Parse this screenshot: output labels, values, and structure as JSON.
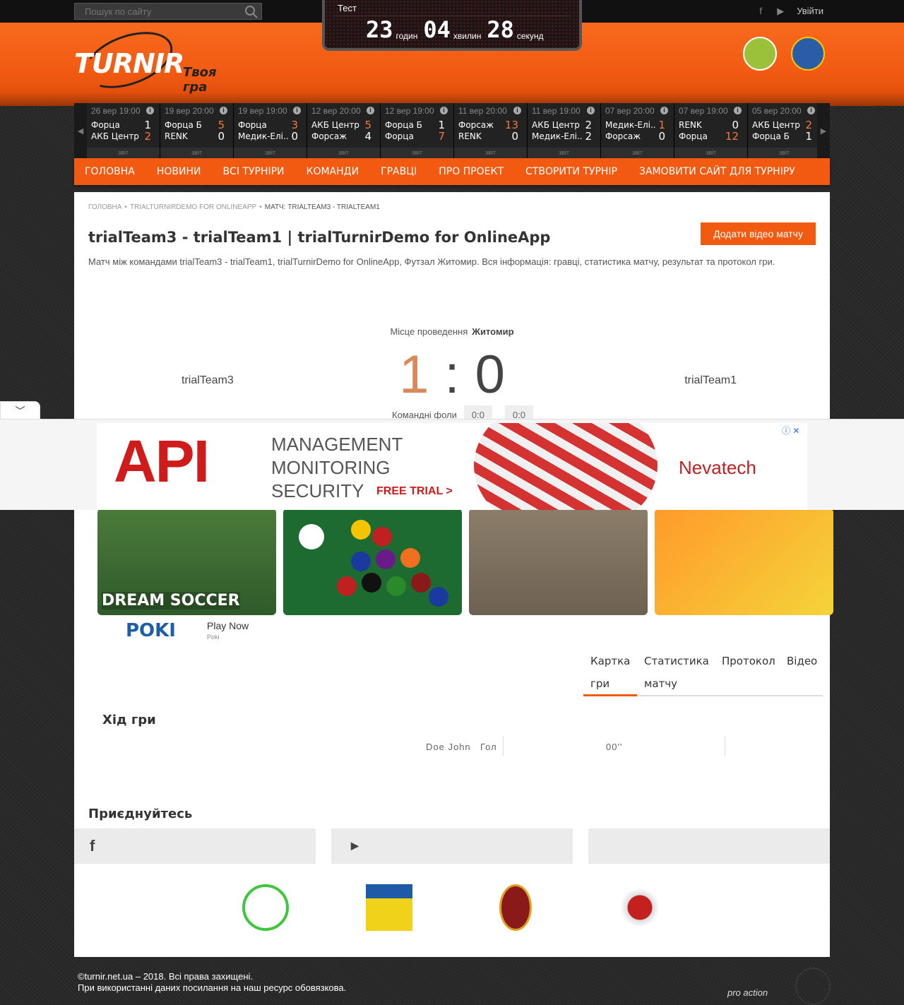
{
  "search": {
    "placeholder": "Пошук по сайту"
  },
  "top": {
    "login": "Увійти"
  },
  "countdown": {
    "title": "Тест",
    "hours": "23",
    "hours_label": "годин",
    "minutes": "04",
    "minutes_label": "хвилин",
    "seconds": "28",
    "seconds_label": "секунд"
  },
  "logo": {
    "text": "TURNIR",
    "tagline": "Твоя гра"
  },
  "matches": [
    {
      "date": "26 вер 19:00",
      "team1": "Форца",
      "score1": "1",
      "team2": "АКБ Центр",
      "score2": "2",
      "report": "звіт",
      "winner": 2
    },
    {
      "date": "19 вер 20:00",
      "team1": "Форца Б",
      "score1": "5",
      "team2": "RENK",
      "score2": "0",
      "report": "звіт",
      "winner": 1
    },
    {
      "date": "19 вер 19:00",
      "team1": "Форца",
      "score1": "3",
      "team2": "Медик-Елі..",
      "score2": "0",
      "report": "звіт",
      "winner": 1
    },
    {
      "date": "12 вер 20:00",
      "team1": "АКБ Центр",
      "score1": "5",
      "team2": "Форсаж",
      "score2": "4",
      "report": "звіт",
      "winner": 1
    },
    {
      "date": "12 вер 19:00",
      "team1": "Форца Б",
      "score1": "1",
      "team2": "Форца",
      "score2": "7",
      "report": "звіт",
      "winner": 2
    },
    {
      "date": "11 вер 20:00",
      "team1": "Форсаж",
      "score1": "13",
      "team2": "RENK",
      "score2": "0",
      "report": "звіт",
      "winner": 1
    },
    {
      "date": "11 вер 19:00",
      "team1": "АКБ Центр",
      "score1": "2",
      "team2": "Медик-Елі..",
      "score2": "2",
      "report": "звіт",
      "winner": 0
    },
    {
      "date": "07 вер 20:00",
      "team1": "Медик-Елі..",
      "score1": "1",
      "team2": "Форсаж",
      "score2": "0",
      "report": "звіт",
      "winner": 1
    },
    {
      "date": "07 вер 19:00",
      "team1": "RENK",
      "score1": "0",
      "team2": "Форца",
      "score2": "12",
      "report": "звіт",
      "winner": 2
    },
    {
      "date": "05 вер 20:00",
      "team1": "АКБ Центр",
      "score1": "2",
      "team2": "Форца Б",
      "score2": "1",
      "report": "звіт",
      "winner": 1
    }
  ],
  "nav": [
    "Головна",
    "Новини",
    "Всі турніри",
    "Команди",
    "Гравці",
    "Про проект",
    "Створити турнір",
    "Замовити сайт для турніру"
  ],
  "breadcrumb": {
    "home": "Головна",
    "tournament": "trialTurnirDemo for OnlineApp",
    "current": "Матч: trialTeam3 - trialTeam1"
  },
  "match": {
    "title": "trialTeam3 - trialTeam1 | trialTurnirDemo for OnlineApp",
    "add_video": "Додати відео матчу",
    "description": "Матч між командами trialTeam3 - trialTeam1, trialTurnirDemo for OnlineApp, Футзал Житомир. Вся інформація: гравці, статистика матчу, результат та протокол гри.",
    "venue_label": "Місце проведення",
    "venue": "Житомир",
    "home_team": "trialTeam3",
    "away_team": "trialTeam1",
    "home_score": "1",
    "away_score": "0",
    "score_sep": ":",
    "fouls_label": "Командні фоли",
    "home_fouls": "0:0",
    "away_fouls": "0:0"
  },
  "games_ad": {
    "game1": "DREAM SOCCER",
    "brand": "POKI",
    "cta": "Play Now",
    "source": "Poki"
  },
  "tabs": [
    "Картка гри",
    "Статистика матчу",
    "Протокол",
    "Відео"
  ],
  "game_flow": {
    "title": "Хід гри",
    "player": "Doe John",
    "event": "Гол",
    "minute": "00''"
  },
  "join": {
    "title": "Приєднуйтесь"
  },
  "footer": {
    "copyright": "©turnir.net.ua – 2018. Всі права захищені.",
    "notice": "При використанні даних посилання на наш ресурс обовязкова.",
    "dev": "pro action"
  },
  "ad": {
    "headline": "API",
    "line1": "MANAGEMENT",
    "line2": "MONITORING",
    "line3": "SECURITY",
    "cta": "FREE TRIAL >",
    "brand": "Nevatech"
  },
  "colors": {
    "accent": "#f25a12",
    "win": "#f07a3a",
    "home_score": "#d9895a"
  }
}
